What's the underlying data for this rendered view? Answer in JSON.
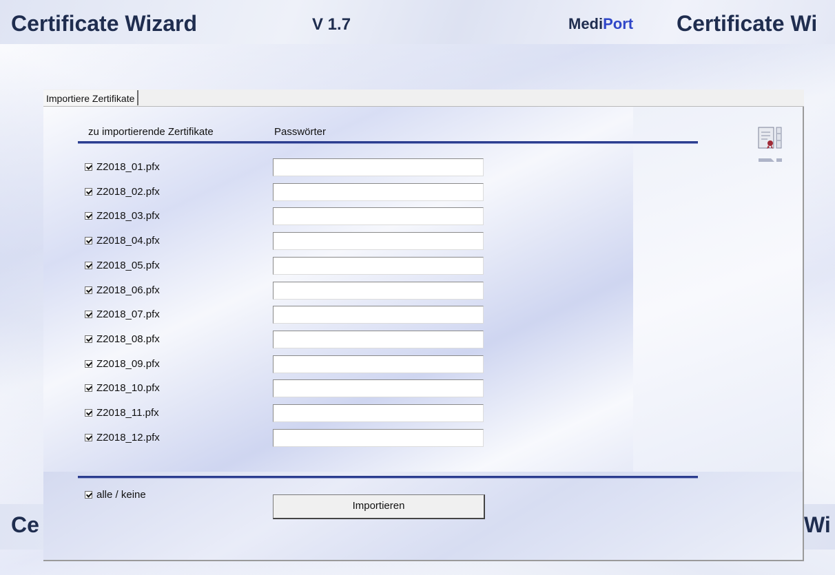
{
  "header": {
    "title": "Certificate Wizard",
    "version": "V 1.7",
    "brand_part1": "Medi",
    "brand_part2": "Port",
    "title_repeat": "Certificate Wi",
    "bottom_left_fragment": "Ce",
    "bottom_right_fragment": "Wi"
  },
  "tab": {
    "label": "Importiere  Zertifikate"
  },
  "columns": {
    "certificates": "zu importierende Zertifikate",
    "passwords": "Passwörter"
  },
  "certificates": [
    {
      "file": "Z2018_01.pfx",
      "checked": true,
      "password": ""
    },
    {
      "file": "Z2018_02.pfx",
      "checked": true,
      "password": ""
    },
    {
      "file": "Z2018_03.pfx",
      "checked": true,
      "password": ""
    },
    {
      "file": "Z2018_04.pfx",
      "checked": true,
      "password": ""
    },
    {
      "file": "Z2018_05.pfx",
      "checked": true,
      "password": ""
    },
    {
      "file": "Z2018_06.pfx",
      "checked": true,
      "password": ""
    },
    {
      "file": "Z2018_07.pfx",
      "checked": true,
      "password": ""
    },
    {
      "file": "Z2018_08.pfx",
      "checked": true,
      "password": ""
    },
    {
      "file": "Z2018_09.pfx",
      "checked": true,
      "password": ""
    },
    {
      "file": "Z2018_10.pfx",
      "checked": true,
      "password": ""
    },
    {
      "file": "Z2018_11.pfx",
      "checked": true,
      "password": ""
    },
    {
      "file": "Z2018_12.pfx",
      "checked": true,
      "password": ""
    }
  ],
  "footer": {
    "select_all_label": "alle / keine",
    "select_all_checked": true,
    "import_button": "Importieren"
  },
  "icons": {
    "certificate": "certificate-icon"
  },
  "colors": {
    "title": "#1f2d4f",
    "brand_accent": "#2f46c8",
    "rule": "#2b3d8f"
  }
}
